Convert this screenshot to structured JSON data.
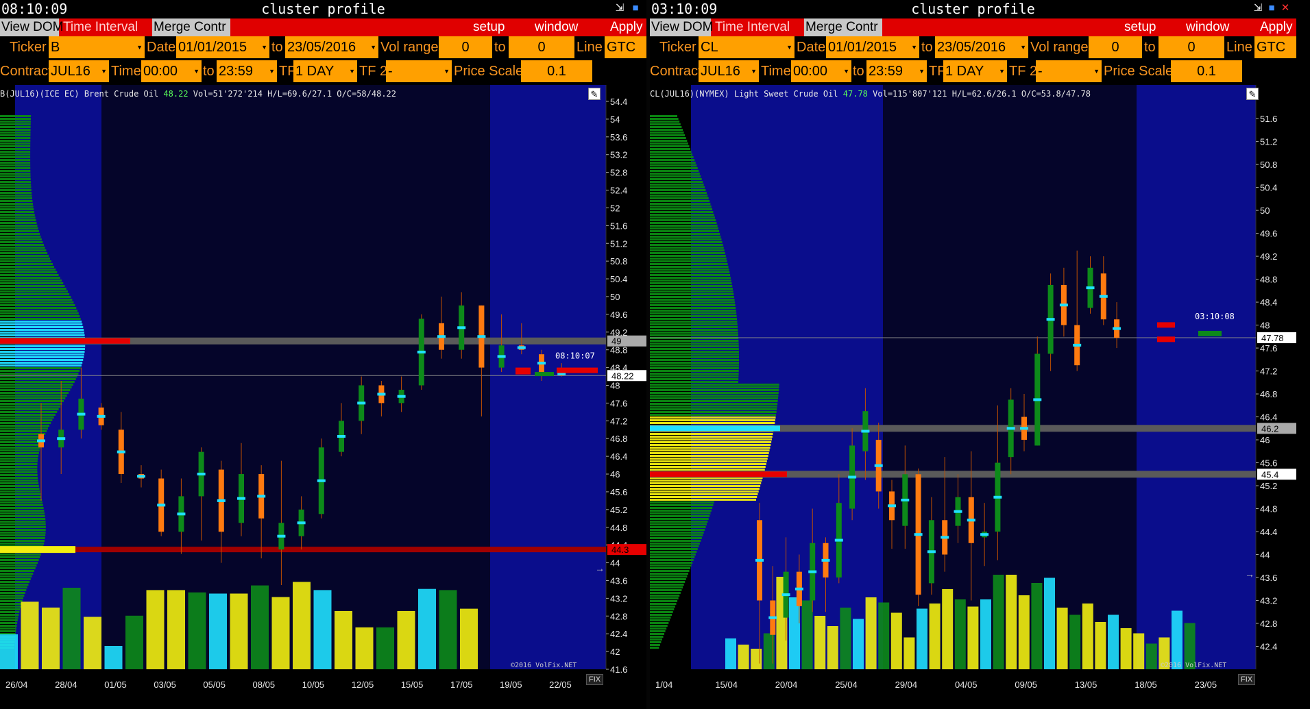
{
  "windows": [
    {
      "id": "L",
      "clock": "08:10:09",
      "title": "cluster profile",
      "menu": {
        "view_dom": "View DOM",
        "time_interval": "Time Interval",
        "merge": "Merge Contr",
        "setup": "setup",
        "window": "window",
        "apply": "Apply"
      },
      "controls": {
        "ticker_label": "Ticker",
        "ticker": "B",
        "date_label": "Date",
        "date_from": "01/01/2015",
        "to_label": "to",
        "date_to": "23/05/2016",
        "volrange_label": "Vol range",
        "vol_from": "0",
        "vol_to": "0",
        "line_label": "Line",
        "line": "GTC",
        "contract_label": "Contract",
        "contract": "JUL16",
        "time_label": "Time",
        "time_from": "00:00",
        "time_to": "23:59",
        "tf_label": "TF",
        "tf": "1 DAY",
        "tf2_label": "TF 2",
        "tf2": "-",
        "pricescale_label": "Price Scale",
        "pricescale": "0.1"
      },
      "info": {
        "name": "B(JUL16)(ICE EC) Brent Crude Oil",
        "last": "48.22",
        "rest": "Vol=51'272'214 H/L=69.6/27.1 O/C=58/48.22"
      },
      "copyright": "©2016 VolFix.NET",
      "fix": "FIX",
      "price_tags": {
        "gray": "49",
        "last": "48.22",
        "red": "44.3",
        "time": "08:10:07"
      },
      "colors": {
        "orange": "#ff7a10",
        "green": "#0d8a1a",
        "cyan": "#20e0ff",
        "yellow": "#f2ee10",
        "red": "#e60000"
      },
      "chart_data": {
        "type": "candlestick-cluster",
        "y_ticks": [
          "54.4",
          "54",
          "53.6",
          "53.2",
          "52.8",
          "52.4",
          "52",
          "51.6",
          "51.2",
          "50.8",
          "50.4",
          "50",
          "49.6",
          "49.2",
          "48.8",
          "48.4",
          "48",
          "47.6",
          "47.2",
          "46.8",
          "46.4",
          "46",
          "45.6",
          "45.2",
          "44.8",
          "44.4",
          "44",
          "43.6",
          "43.2",
          "42.8",
          "42.4",
          "42",
          "41.6"
        ],
        "ylim": [
          41.6,
          54.4
        ],
        "x_ticks": [
          "26/04",
          "28/04",
          "01/05",
          "03/05",
          "05/05",
          "08/05",
          "10/05",
          "12/05",
          "15/05",
          "17/05",
          "19/05",
          "22/05"
        ],
        "candles": [
          {
            "o": 46.9,
            "c": 46.6,
            "h": 47.6,
            "l": 45.4
          },
          {
            "o": 46.6,
            "c": 47.0,
            "h": 48.1,
            "l": 46.0
          },
          {
            "o": 47.0,
            "c": 47.7,
            "h": 48.4,
            "l": 46.8
          },
          {
            "o": 47.5,
            "c": 47.1,
            "h": 47.6,
            "l": 47.0
          },
          {
            "o": 47.0,
            "c": 46.0,
            "h": 47.4,
            "l": 45.8
          },
          {
            "o": 46.0,
            "c": 45.9,
            "h": 46.2,
            "l": 45.7
          },
          {
            "o": 45.9,
            "c": 44.7,
            "h": 46.1,
            "l": 44.6
          },
          {
            "o": 44.7,
            "c": 45.5,
            "h": 45.9,
            "l": 44.2
          },
          {
            "o": 45.5,
            "c": 46.5,
            "h": 46.6,
            "l": 44.5
          },
          {
            "o": 46.1,
            "c": 44.7,
            "h": 46.3,
            "l": 44.0
          },
          {
            "o": 44.9,
            "c": 46.0,
            "h": 46.7,
            "l": 44.6
          },
          {
            "o": 46.0,
            "c": 45.0,
            "h": 46.2,
            "l": 44.1
          },
          {
            "o": 44.3,
            "c": 44.9,
            "h": 46.3,
            "l": 43.5
          },
          {
            "o": 44.6,
            "c": 45.2,
            "h": 45.5,
            "l": 44.3
          },
          {
            "o": 45.1,
            "c": 46.6,
            "h": 46.8,
            "l": 45.0
          },
          {
            "o": 46.5,
            "c": 47.2,
            "h": 47.6,
            "l": 46.4
          },
          {
            "o": 47.2,
            "c": 48.0,
            "h": 48.2,
            "l": 46.9
          },
          {
            "o": 48.0,
            "c": 47.6,
            "h": 48.1,
            "l": 47.3
          },
          {
            "o": 47.6,
            "c": 47.9,
            "h": 48.2,
            "l": 47.4
          },
          {
            "o": 48.0,
            "c": 49.5,
            "h": 49.6,
            "l": 47.9
          },
          {
            "o": 49.4,
            "c": 48.8,
            "h": 50.0,
            "l": 48.6
          },
          {
            "o": 48.8,
            "c": 49.8,
            "h": 50.1,
            "l": 48.6
          },
          {
            "o": 49.8,
            "c": 48.4,
            "h": 49.8,
            "l": 47.3
          },
          {
            "o": 48.4,
            "c": 48.9,
            "h": 49.6,
            "l": 48.3
          },
          {
            "o": 48.9,
            "c": 48.8,
            "h": 49.4,
            "l": 48.7
          },
          {
            "o": 48.7,
            "c": 48.3,
            "h": 48.8,
            "l": 48.1
          },
          {
            "o": 48.3,
            "c": 48.22,
            "h": 48.5,
            "l": 48.2
          }
        ],
        "volume": [
          0.3,
          0.58,
          0.53,
          0.7,
          0.45,
          0.2,
          0.46,
          0.68,
          0.68,
          0.66,
          0.65,
          0.65,
          0.72,
          0.62,
          0.75,
          0.68,
          0.5,
          0.36,
          0.36,
          0.5,
          0.69,
          0.68,
          0.52
        ]
      }
    },
    {
      "id": "R",
      "clock": "03:10:09",
      "title": "cluster profile",
      "menu": {
        "view_dom": "View DOM",
        "time_interval": "Time Interval",
        "merge": "Merge Contr",
        "setup": "setup",
        "window": "window",
        "apply": "Apply"
      },
      "controls": {
        "ticker_label": "Ticker",
        "ticker": "CL",
        "date_label": "Date",
        "date_from": "01/01/2015",
        "to_label": "to",
        "date_to": "23/05/2016",
        "volrange_label": "Vol range",
        "vol_from": "0",
        "vol_to": "0",
        "line_label": "Line",
        "line": "GTC",
        "contract_label": "Contract",
        "contract": "JUL16",
        "time_label": "Time",
        "time_from": "00:00",
        "time_to": "23:59",
        "tf_label": "TF",
        "tf": "1 DAY",
        "tf2_label": "TF 2",
        "tf2": "-",
        "pricescale_label": "Price Scale",
        "pricescale": "0.1"
      },
      "info": {
        "name": "CL(JUL16)(NYMEX) Light Sweet Crude Oil",
        "last": "47.78",
        "rest": "Vol=115'807'121 H/L=62.6/26.1 O/C=53.8/47.78"
      },
      "copyright": "©2016 VolFix.NET",
      "fix": "FIX",
      "price_tags": {
        "gray1": "46.2",
        "gray2": "45.4",
        "last": "47.78",
        "time": "03:10:08"
      },
      "colors": {
        "orange": "#ff7a10",
        "green": "#0d8a1a",
        "cyan": "#20e0ff",
        "yellow": "#f2ee10",
        "red": "#e60000"
      },
      "chart_data": {
        "type": "candlestick-cluster",
        "y_ticks": [
          "51.6",
          "51.2",
          "50.8",
          "50.4",
          "50",
          "49.6",
          "49.2",
          "48.8",
          "48.4",
          "48",
          "47.6",
          "47.2",
          "46.8",
          "46.4",
          "46",
          "45.6",
          "45.2",
          "44.8",
          "44.4",
          "44",
          "43.6",
          "43.2",
          "42.8",
          "42.4"
        ],
        "ylim": [
          42.0,
          51.9
        ],
        "x_ticks": [
          "1/04",
          "15/04",
          "20/04",
          "25/04",
          "29/04",
          "04/05",
          "09/05",
          "13/05",
          "18/05",
          "23/05"
        ],
        "candles": [
          {
            "o": 44.6,
            "c": 43.2,
            "h": 44.9,
            "l": 42.1
          },
          {
            "o": 43.2,
            "c": 42.6,
            "h": 43.8,
            "l": 42.1
          },
          {
            "o": 42.9,
            "c": 43.7,
            "h": 44.3,
            "l": 42.5
          },
          {
            "o": 43.7,
            "c": 43.1,
            "h": 44.0,
            "l": 42.8
          },
          {
            "o": 43.2,
            "c": 44.2,
            "h": 44.8,
            "l": 43.0
          },
          {
            "o": 44.2,
            "c": 43.6,
            "h": 44.3,
            "l": 43.0
          },
          {
            "o": 43.6,
            "c": 44.9,
            "h": 45.4,
            "l": 43.5
          },
          {
            "o": 44.8,
            "c": 45.9,
            "h": 46.2,
            "l": 44.6
          },
          {
            "o": 45.8,
            "c": 46.5,
            "h": 46.9,
            "l": 45.3
          },
          {
            "o": 46.0,
            "c": 45.1,
            "h": 46.3,
            "l": 44.8
          },
          {
            "o": 45.1,
            "c": 44.6,
            "h": 45.3,
            "l": 44.1
          },
          {
            "o": 44.5,
            "c": 45.4,
            "h": 45.9,
            "l": 44.1
          },
          {
            "o": 45.4,
            "c": 43.3,
            "h": 45.5,
            "l": 43.1
          },
          {
            "o": 43.5,
            "c": 44.6,
            "h": 45.0,
            "l": 43.3
          },
          {
            "o": 44.6,
            "c": 44.0,
            "h": 45.7,
            "l": 43.7
          },
          {
            "o": 44.5,
            "c": 45.0,
            "h": 45.4,
            "l": 44.2
          },
          {
            "o": 45.0,
            "c": 44.2,
            "h": 45.8,
            "l": 43.2
          },
          {
            "o": 44.3,
            "c": 44.4,
            "h": 44.9,
            "l": 43.8
          },
          {
            "o": 44.4,
            "c": 45.6,
            "h": 46.6,
            "l": 43.9
          },
          {
            "o": 45.7,
            "c": 46.7,
            "h": 46.9,
            "l": 45.4
          },
          {
            "o": 46.4,
            "c": 46.0,
            "h": 46.8,
            "l": 45.8
          },
          {
            "o": 45.9,
            "c": 47.5,
            "h": 47.8,
            "l": 45.9
          },
          {
            "o": 47.5,
            "c": 48.7,
            "h": 48.9,
            "l": 47.2
          },
          {
            "o": 48.7,
            "c": 48.0,
            "h": 49.0,
            "l": 47.8
          },
          {
            "o": 48.0,
            "c": 47.3,
            "h": 49.3,
            "l": 47.2
          },
          {
            "o": 48.3,
            "c": 49.0,
            "h": 49.2,
            "l": 48.2
          },
          {
            "o": 48.9,
            "c": 48.1,
            "h": 49.2,
            "l": 48.0
          },
          {
            "o": 48.1,
            "c": 47.78,
            "h": 48.4,
            "l": 47.6
          }
        ],
        "volume": [
          0.3,
          0.24,
          0.2,
          0.35,
          0.9,
          0.7,
          0.67,
          0.52,
          0.42,
          0.6,
          0.49,
          0.7,
          0.65,
          0.55,
          0.31,
          0.59,
          0.64,
          0.78,
          0.68,
          0.61,
          0.68,
          0.92,
          0.92,
          0.72,
          0.84,
          0.89,
          0.6,
          0.53,
          0.64,
          0.46,
          0.53,
          0.4,
          0.35,
          0.25,
          0.31,
          0.57,
          0.45
        ]
      }
    }
  ]
}
